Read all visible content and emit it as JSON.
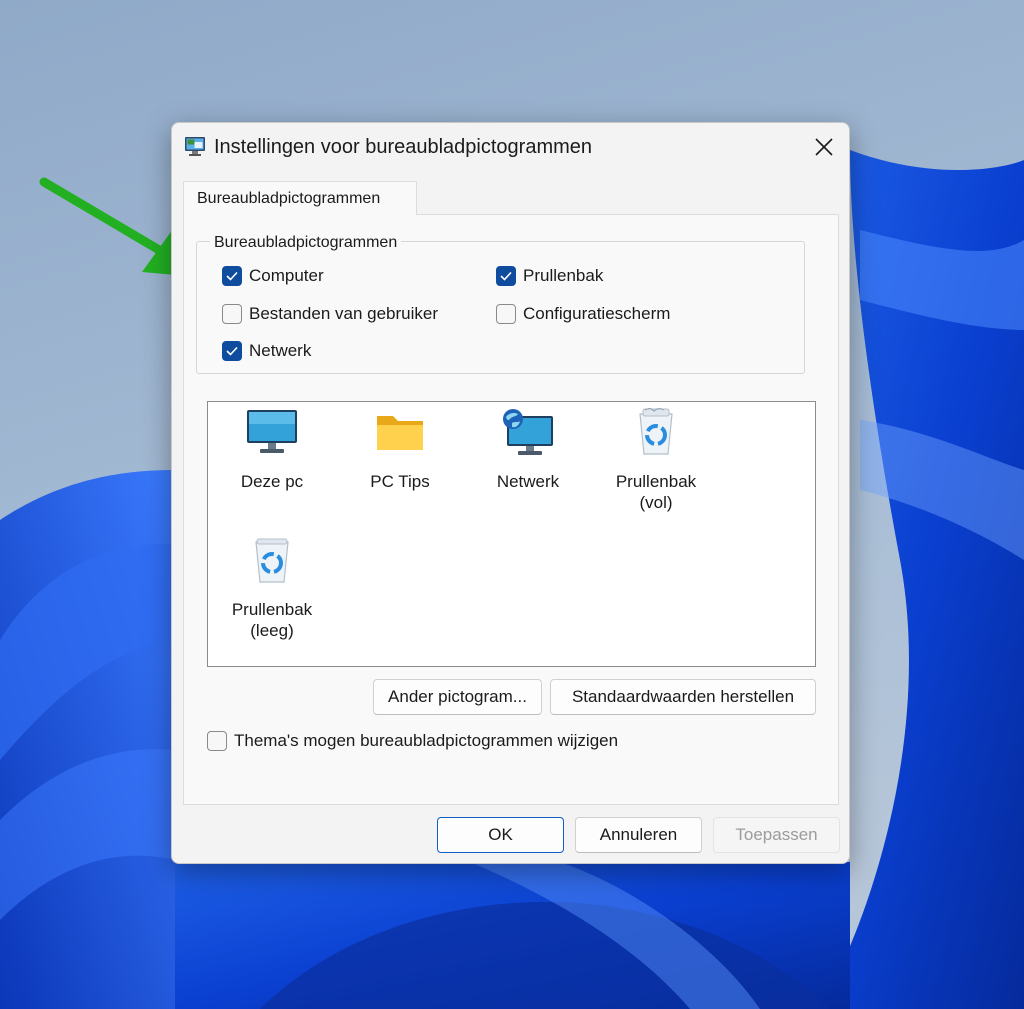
{
  "window": {
    "title": "Instellingen voor bureaubladpictogrammen",
    "title_icon": "desktop-settings-icon",
    "close_icon": "close-icon"
  },
  "tabs": [
    {
      "label": "Bureaubladpictogrammen",
      "selected": true
    }
  ],
  "group": {
    "label": "Bureaubladpictogrammen",
    "checkboxes": [
      {
        "label": "Computer",
        "checked": true
      },
      {
        "label": "Prullenbak",
        "checked": true
      },
      {
        "label": "Bestanden van gebruiker",
        "checked": false
      },
      {
        "label": "Configuratiescherm",
        "checked": false
      },
      {
        "label": "Netwerk",
        "checked": true
      }
    ]
  },
  "icons": [
    {
      "label": "Deze pc",
      "icon": "monitor-icon"
    },
    {
      "label": "PC Tips",
      "icon": "folder-icon"
    },
    {
      "label": "Netwerk",
      "icon": "network-monitor-icon"
    },
    {
      "label": "Prullenbak\n(vol)",
      "icon": "recycle-bin-full-icon"
    },
    {
      "label": "Prullenbak\n(leeg)",
      "icon": "recycle-bin-empty-icon"
    }
  ],
  "buttons": {
    "change_icon": "Ander pictogram...",
    "restore_defaults": "Standaardwaarden herstellen",
    "ok": "OK",
    "cancel": "Annuleren",
    "apply": "Toepassen"
  },
  "theme_checkbox": {
    "label": "Thema's mogen bureaubladpictogrammen wijzigen",
    "checked": false
  },
  "colors": {
    "accent": "#0f4c9e",
    "annotation_arrow": "#22b022"
  }
}
